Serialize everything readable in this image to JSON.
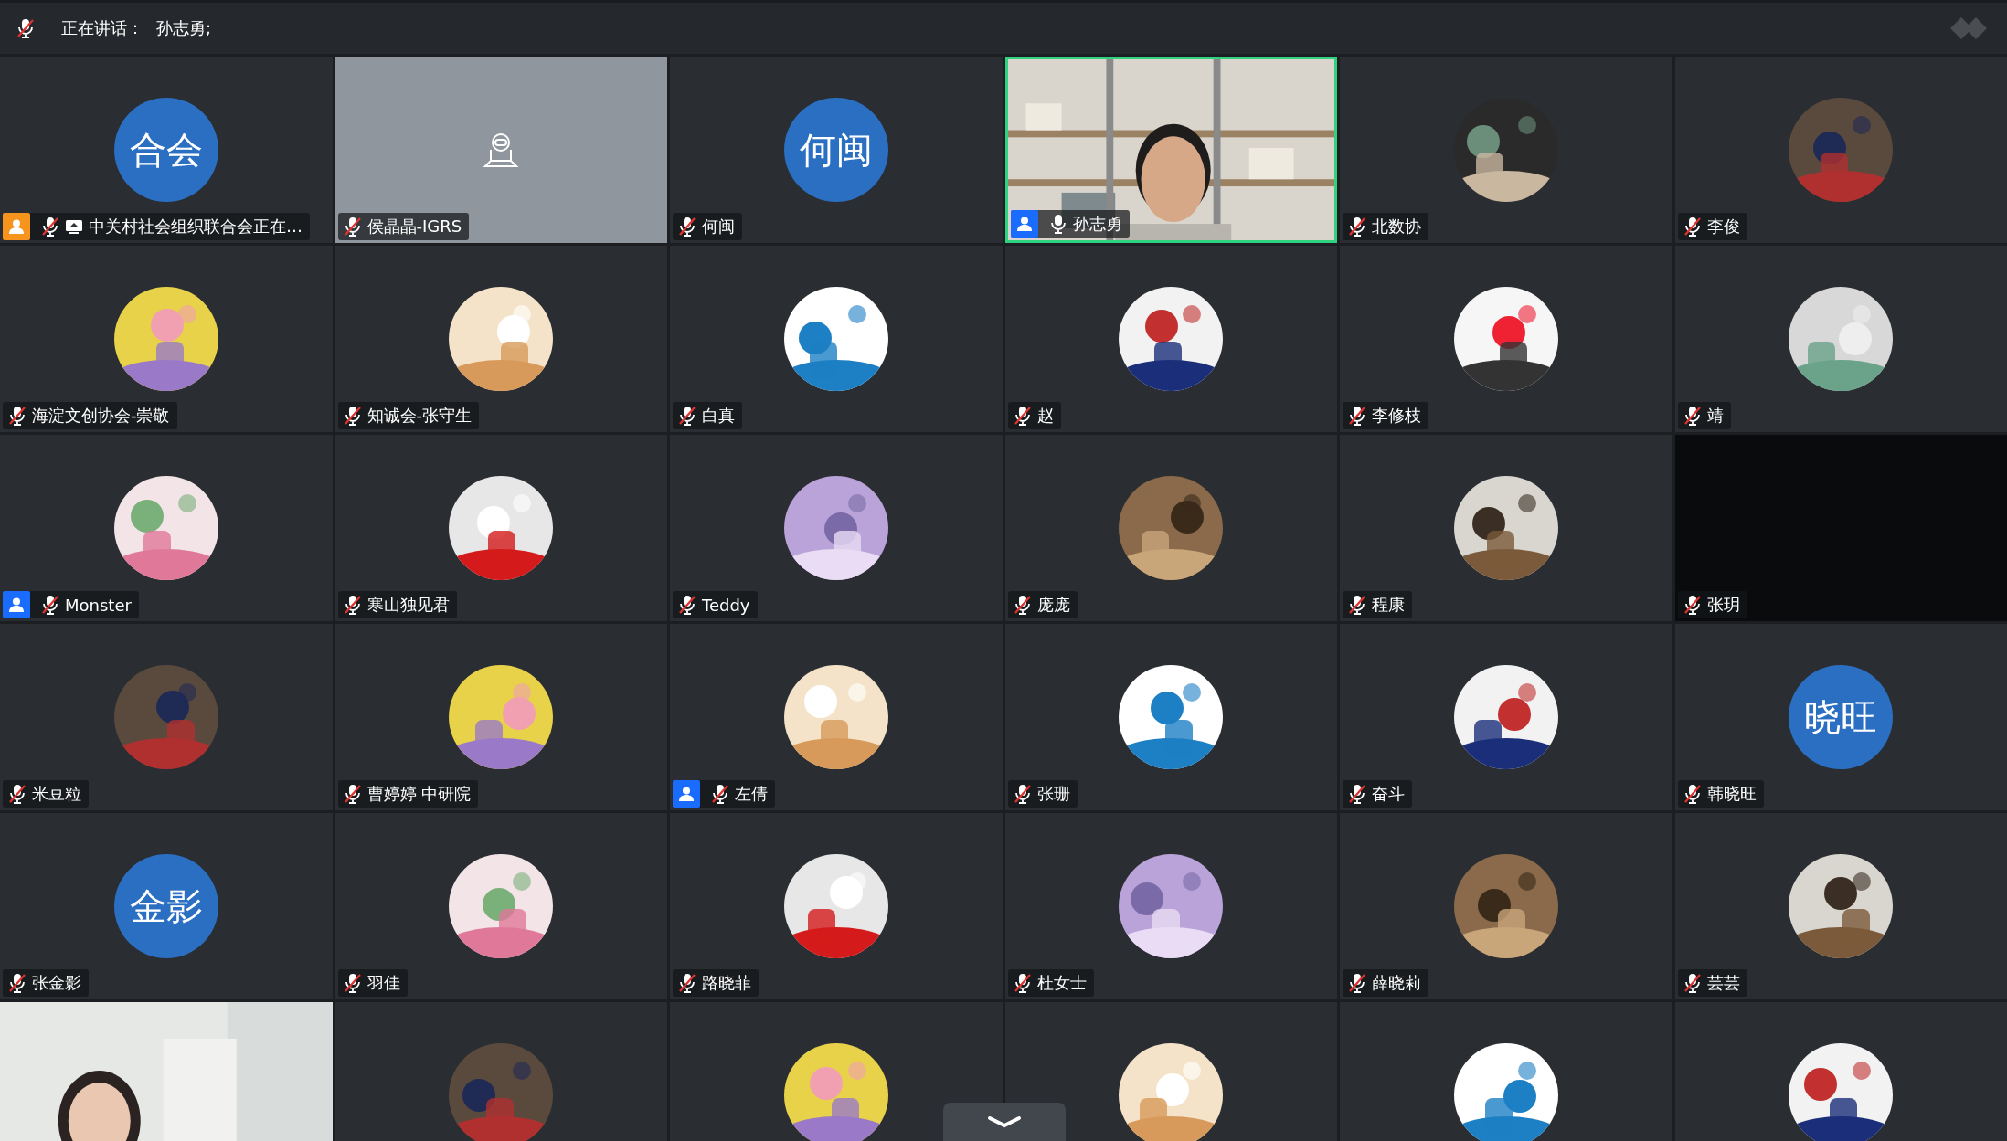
{
  "top_bar": {
    "speaking_label": "正在讲话：",
    "speakers": "孙志勇;"
  },
  "tiles": [
    {
      "kind": "initials",
      "initials": "合会",
      "name": "中关村社会组织联合会正在…",
      "muted": true,
      "sharing": true,
      "color": "#f7941d",
      "speaking": false
    },
    {
      "kind": "camera_off",
      "name": "侯晶晶-IGRS",
      "muted": true,
      "speaking": false
    },
    {
      "kind": "initials",
      "initials": "何闽",
      "name": "何闽",
      "muted": true,
      "speaking": false
    },
    {
      "kind": "video",
      "name": "孙志勇",
      "muted": false,
      "color": "#1a6cff",
      "speaking": true
    },
    {
      "kind": "picture",
      "name": "北数协",
      "muted": true,
      "speaking": false
    },
    {
      "kind": "picture",
      "name": "李俊",
      "muted": true,
      "speaking": false
    },
    {
      "kind": "picture",
      "name": "海淀文创协会-崇敬",
      "muted": true,
      "speaking": false
    },
    {
      "kind": "picture",
      "name": "知诚会-张守生",
      "muted": true,
      "speaking": false
    },
    {
      "kind": "picture",
      "name": "白真",
      "muted": true,
      "speaking": false
    },
    {
      "kind": "picture",
      "name": "赵",
      "muted": true,
      "speaking": false
    },
    {
      "kind": "picture",
      "name": "李修枝",
      "muted": true,
      "speaking": false
    },
    {
      "kind": "picture",
      "name": "靖",
      "muted": true,
      "speaking": false
    },
    {
      "kind": "picture",
      "name": "Monster",
      "muted": true,
      "color": "#1a6cff",
      "speaking": false
    },
    {
      "kind": "picture",
      "name": "寒山独见君",
      "muted": true,
      "speaking": false
    },
    {
      "kind": "picture",
      "name": "Teddy",
      "muted": true,
      "speaking": false
    },
    {
      "kind": "picture",
      "name": "庞庞",
      "muted": true,
      "speaking": false
    },
    {
      "kind": "picture",
      "name": "程康",
      "muted": true,
      "speaking": false
    },
    {
      "kind": "blank",
      "name": "张玥",
      "muted": true,
      "speaking": false
    },
    {
      "kind": "picture",
      "name": "米豆粒",
      "muted": true,
      "speaking": false
    },
    {
      "kind": "picture",
      "name": "曹婷婷 中研院",
      "muted": true,
      "speaking": false
    },
    {
      "kind": "picture",
      "name": "左倩",
      "muted": true,
      "color": "#1a6cff",
      "speaking": false
    },
    {
      "kind": "picture",
      "name": "张珊",
      "muted": true,
      "speaking": false
    },
    {
      "kind": "picture",
      "name": "奋斗",
      "muted": true,
      "speaking": false
    },
    {
      "kind": "initials",
      "initials": "晓旺",
      "name": "韩晓旺",
      "muted": true,
      "speaking": false
    },
    {
      "kind": "initials",
      "initials": "金影",
      "name": "张金影",
      "muted": true,
      "speaking": false
    },
    {
      "kind": "picture",
      "name": "羽佳",
      "muted": true,
      "speaking": false
    },
    {
      "kind": "picture",
      "name": "路晓菲",
      "muted": true,
      "speaking": false
    },
    {
      "kind": "picture",
      "name": "杜女士",
      "muted": true,
      "speaking": false
    },
    {
      "kind": "picture",
      "name": "薛晓莉",
      "muted": true,
      "speaking": false
    },
    {
      "kind": "picture",
      "name": "芸芸",
      "muted": true,
      "speaking": false
    },
    {
      "kind": "video",
      "speaking": false
    },
    {
      "kind": "picture",
      "speaking": false
    },
    {
      "kind": "picture",
      "speaking": false
    },
    {
      "kind": "picture",
      "speaking": false
    },
    {
      "kind": "picture",
      "speaking": false
    },
    {
      "kind": "picture",
      "speaking": false
    }
  ]
}
